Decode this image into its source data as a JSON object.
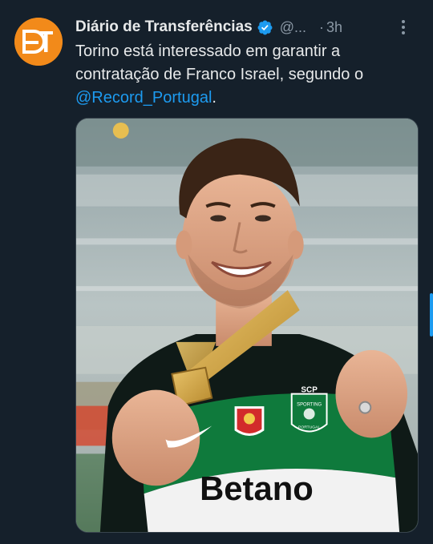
{
  "tweet": {
    "display_name": "Diário de Transferências",
    "handle": "@...",
    "separator": "·",
    "time": "3h",
    "text_before_mention": "Torino está interessado em garantir a contratação de Franco Israel, segundo o ",
    "mention": "@Record_Portugal",
    "text_after_mention": ".",
    "avatar_initials": "DT"
  },
  "media": {
    "jersey_sponsor": "Betano",
    "crest_text_top": "SCP",
    "crest_text": "SPORTING",
    "crest_text_bottom": "PORTUGAL"
  },
  "colors": {
    "background": "#15202b",
    "accent": "#1d9bf0",
    "avatar_orange": "#f28a1a",
    "jersey_green": "#0f7a3c"
  },
  "icons": {
    "verified": "verified-badge-icon",
    "more": "more-options-icon"
  }
}
